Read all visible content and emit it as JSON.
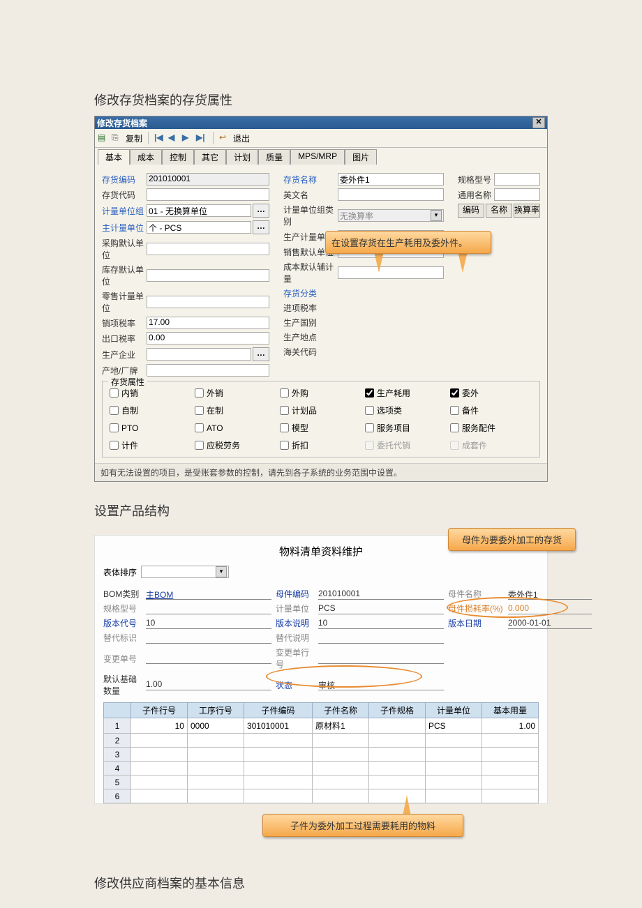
{
  "headings": {
    "h1": "修改存货档案的存货属性",
    "h2": "设置产品结构",
    "h3": "修改供应商档案的基本信息"
  },
  "dialog": {
    "title": "修改存货档案",
    "toolbar": {
      "copy": "复制",
      "exit": "退出"
    },
    "tabs": [
      "基本",
      "成本",
      "控制",
      "其它",
      "计划",
      "质量",
      "MPS/MRP",
      "图片"
    ],
    "labels": {
      "inv_code": "存货编码",
      "inv_daima": "存货代码",
      "unit_group": "计量单位组",
      "main_unit": "主计量单位",
      "purchase_unit": "采购默认单位",
      "stock_unit": "库存默认单位",
      "retail_unit": "零售计量单位",
      "sale_tax": "销项税率",
      "export_tax": "出口税率",
      "producer": "生产企业",
      "origin": "产地/厂牌",
      "inv_name": "存货名称",
      "en_name": "英文名",
      "unit_group_type": "计量单位组类别",
      "prod_unit": "生产计量单位",
      "sale_unit": "销售默认单位",
      "cost_aux": "成本默认辅计量",
      "inv_cat": "存货分类",
      "in_tax": "进项税率",
      "prod_country": "生产国别",
      "prod_place": "生产地点",
      "customs_code": "海关代码",
      "spec": "规格型号",
      "common_name": "通用名称",
      "code_col": "编码",
      "name_col": "名称",
      "rate_col": "换算率",
      "group_title": "存货属性"
    },
    "values": {
      "inv_code": "201010001",
      "unit_group": "01 - 无换算单位",
      "main_unit": "个 - PCS",
      "sale_tax": "17.00",
      "export_tax": "0.00",
      "inv_name": "委外件1",
      "unit_group_type": "无换算率"
    },
    "checkboxes": {
      "dom_sale": "内销",
      "export": "外销",
      "out_purchase": "外购",
      "prod_consume": "生产耗用",
      "outsource": "委外",
      "self_made": "自制",
      "in_prod": "在制",
      "plan_item": "计划品",
      "option": "选项类",
      "spare": "备件",
      "pto": "PTO",
      "ato": "ATO",
      "model": "模型",
      "service_item": "服务项目",
      "service_part": "服务配件",
      "count": "计件",
      "labor": "应税劳务",
      "discount": "折扣",
      "consign": "委托代销",
      "set": "成套件"
    },
    "footer": "如有无法设置的项目，是受账套参数的控制，请先到各子系统的业务范围中设置。"
  },
  "callouts": {
    "c1": "在设置存货在生产耗用及委外件。",
    "c2": "母件为要委外加工的存货",
    "c3": "子件为委外加工过程需要耗用的物料"
  },
  "bom": {
    "title": "物料清单资料维护",
    "sort_label": "表体排序",
    "labels": {
      "bom_type": "BOM类别",
      "parent_code": "母件编码",
      "parent_name": "母件名称",
      "spec": "规格型号",
      "unit": "计量单位",
      "loss": "母件损耗率(%)",
      "ver_code": "版本代号",
      "ver_desc": "版本说明",
      "ver_date": "版本日期",
      "sub_flag": "替代标识",
      "sub_desc": "替代说明",
      "change_no": "变更单号",
      "change_line": "变更单行号",
      "base_qty": "默认基础数量",
      "status": "状态"
    },
    "values": {
      "bom_type": "主BOM",
      "parent_code": "201010001",
      "parent_name": "委外件1",
      "unit": "PCS",
      "loss": "0.000",
      "ver_code": "10",
      "ver_desc": "10",
      "ver_date": "2000-01-01",
      "base_qty": "1.00",
      "status": "审核"
    },
    "cols": [
      "子件行号",
      "工序行号",
      "子件编码",
      "子件名称",
      "子件规格",
      "计量单位",
      "基本用量"
    ],
    "rows": [
      {
        "n": "1",
        "line": "10",
        "op": "0000",
        "code": "301010001",
        "name": "原材料1",
        "spec": "",
        "unit": "PCS",
        "qty": "1.00"
      },
      {
        "n": "2",
        "line": "",
        "op": "",
        "code": "",
        "name": "",
        "spec": "",
        "unit": "",
        "qty": ""
      },
      {
        "n": "3",
        "line": "",
        "op": "",
        "code": "",
        "name": "",
        "spec": "",
        "unit": "",
        "qty": ""
      },
      {
        "n": "4",
        "line": "",
        "op": "",
        "code": "",
        "name": "",
        "spec": "",
        "unit": "",
        "qty": ""
      },
      {
        "n": "5",
        "line": "",
        "op": "",
        "code": "",
        "name": "",
        "spec": "",
        "unit": "",
        "qty": ""
      },
      {
        "n": "6",
        "line": "",
        "op": "",
        "code": "",
        "name": "",
        "spec": "",
        "unit": "",
        "qty": ""
      }
    ]
  }
}
